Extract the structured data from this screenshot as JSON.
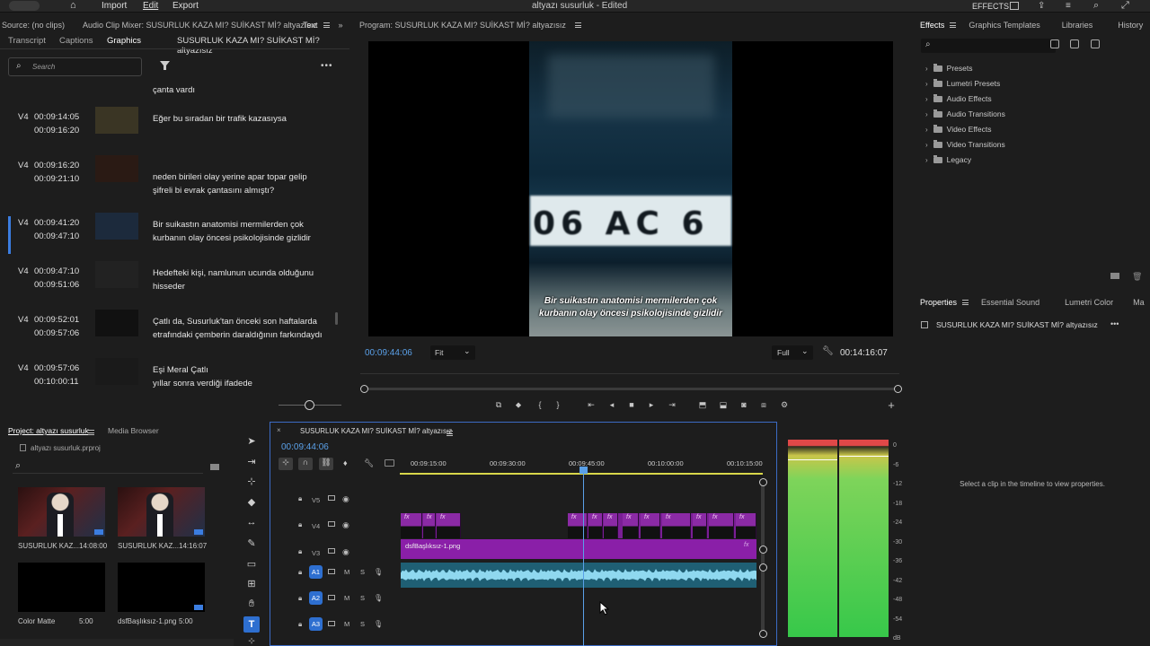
{
  "menu": {
    "import": "Import",
    "edit": "Edit",
    "export": "Export",
    "title": "altyazı susurluk - Edited",
    "effects_label": "EFFECTS"
  },
  "source": {
    "header": "Source: (no clips)",
    "mixer": "Audio Clip Mixer: SUSURLUK KAZA MI? SUİKAST Mİ? altyazısız",
    "text_tab": "Text",
    "tabs": [
      "Transcript",
      "Captions",
      "Graphics"
    ],
    "seq_title": "SUSURLUK KAZA MI? SUİKAST Mİ? altyazısız",
    "search_placeholder": "Search"
  },
  "captions": [
    {
      "track": "",
      "tc_in": "",
      "tc_out": "",
      "line1": "çanta vardı",
      "line2": ""
    },
    {
      "track": "V4",
      "tc_in": "00:09:14:05",
      "tc_out": "00:09:16:20",
      "line1": "Eğer bu sıradan bir trafik kazasıysa",
      "line2": ""
    },
    {
      "track": "V4",
      "tc_in": "00:09:16:20",
      "tc_out": "00:09:21:10",
      "line1": "neden birileri olay yerine apar topar gelip",
      "line2": "şifreli bi evrak çantasını almıştı?"
    },
    {
      "track": "V4",
      "tc_in": "00:09:41:20",
      "tc_out": "00:09:47:10",
      "line1": "Bir suikastın anatomisi mermilerden çok",
      "line2": "kurbanın olay öncesi psikolojisinde gizlidir"
    },
    {
      "track": "V4",
      "tc_in": "00:09:47:10",
      "tc_out": "00:09:51:06",
      "line1": "Hedefteki kişi, namlunun ucunda olduğunu",
      "line2": "hisseder"
    },
    {
      "track": "V4",
      "tc_in": "00:09:52:01",
      "tc_out": "00:09:57:06",
      "line1": "Çatlı da, Susurluk'tan önceki son haftalarda",
      "line2": "etrafındaki çemberin daraldığının farkındaydı"
    },
    {
      "track": "V4",
      "tc_in": "00:09:57:06",
      "tc_out": "00:10:00:11",
      "line1": "Eşi Meral Çatlı",
      "line2": "yıllar sonra verdiği ifadede"
    }
  ],
  "program": {
    "header": "Program: SUSURLUK KAZA MI? SUİKAST Mİ? altyazısız",
    "plate_text": "06 AC 6",
    "subtitle1": "Bir suikastın anatomisi mermilerden çok",
    "subtitle2": "kurbanın olay öncesi psikolojisinde gizlidir",
    "timecode": "00:09:44:06",
    "fit": "Fit",
    "quality": "Full",
    "duration": "00:14:16:07",
    "playhead_fraction": 0.68
  },
  "effects": {
    "tabs": [
      "Effects",
      "Graphics Templates",
      "Libraries",
      "History"
    ],
    "items": [
      "Presets",
      "Lumetri Presets",
      "Audio Effects",
      "Audio Transitions",
      "Video Effects",
      "Video Transitions",
      "Legacy"
    ]
  },
  "properties": {
    "tabs": [
      "Properties",
      "Essential Sound",
      "Lumetri Color",
      "Ma"
    ],
    "seq": "SUSURLUK KAZA MI? SUİKAST Mİ? altyazısız",
    "empty_msg": "Select a clip in the timeline to view properties."
  },
  "project": {
    "tab": "Project: altyazı susurluk",
    "tab2": "Media Browser",
    "file": "altyazı susurluk.prproj",
    "items": [
      {
        "name": "SUSURLUK KAZ...",
        "duration": "14:08:00"
      },
      {
        "name": "SUSURLUK KAZ...",
        "duration": "14:16:07"
      },
      {
        "name": "Color Matte",
        "duration": "5:00"
      },
      {
        "name": "dsfBaşlıksız-1.png",
        "duration": "5:00"
      }
    ]
  },
  "timeline": {
    "tab": "SUSURLUK KAZA MI? SUİKAST Mİ? altyazısız",
    "timecode": "00:09:44:06",
    "ruler": [
      "00:09:15:00",
      "00:09:30:00",
      "00:09:45:00",
      "00:10:00:00",
      "00:10:15:00"
    ],
    "video_tracks": [
      "V5",
      "V4",
      "V3"
    ],
    "audio_tracks": [
      "A1",
      "A2",
      "A3"
    ],
    "clip_v3": "dsfBaşlıksız-1.png",
    "fx": "fx"
  },
  "meters": {
    "labels": [
      "0",
      "-6",
      "-12",
      "-18",
      "-24",
      "-30",
      "-36",
      "-42",
      "-48",
      "-54",
      "dB"
    ]
  },
  "colors": {
    "accent": "#4a90e2",
    "clip_purple": "#8a1fa8",
    "audio_blue": "#2f7f9a",
    "meter_green": "#37c84a"
  }
}
